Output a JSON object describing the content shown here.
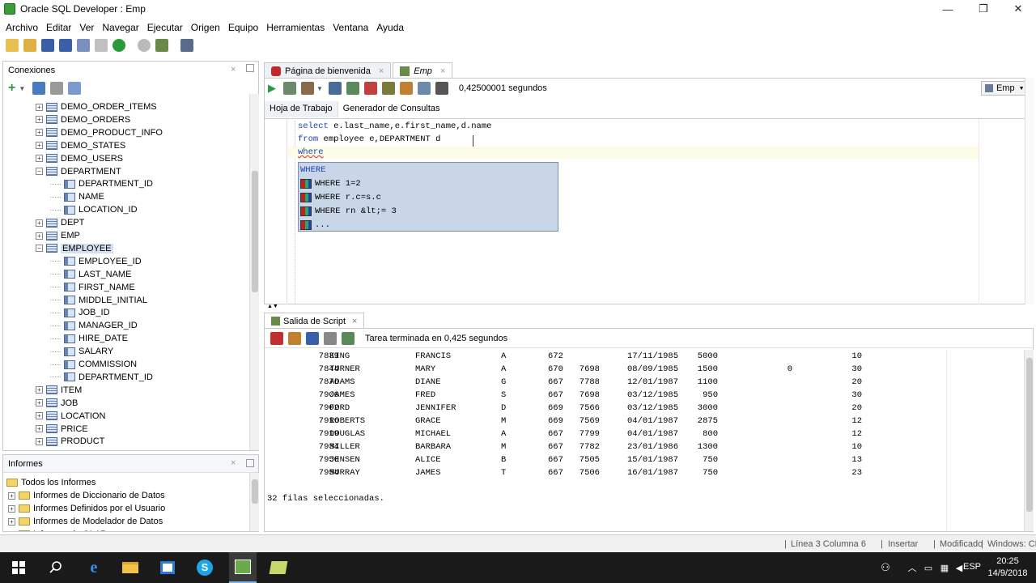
{
  "window": {
    "title": "Oracle SQL Developer : Emp",
    "min": "—",
    "max": "❐",
    "close": "✕"
  },
  "menu": [
    "Archivo",
    "Editar",
    "Ver",
    "Navegar",
    "Ejecutar",
    "Origen",
    "Equipo",
    "Herramientas",
    "Ventana",
    "Ayuda"
  ],
  "connections": {
    "title": "Conexiones",
    "items": [
      {
        "label": "DEMO_ORDER_ITEMS",
        "level": 1,
        "exp": "+",
        "kind": "table"
      },
      {
        "label": "DEMO_ORDERS",
        "level": 1,
        "exp": "+",
        "kind": "table"
      },
      {
        "label": "DEMO_PRODUCT_INFO",
        "level": 1,
        "exp": "+",
        "kind": "table"
      },
      {
        "label": "DEMO_STATES",
        "level": 1,
        "exp": "+",
        "kind": "table"
      },
      {
        "label": "DEMO_USERS",
        "level": 1,
        "exp": "+",
        "kind": "table"
      },
      {
        "label": "DEPARTMENT",
        "level": 1,
        "exp": "−",
        "kind": "table"
      },
      {
        "label": "DEPARTMENT_ID",
        "level": 2,
        "exp": "",
        "kind": "col"
      },
      {
        "label": "NAME",
        "level": 2,
        "exp": "",
        "kind": "col"
      },
      {
        "label": "LOCATION_ID",
        "level": 2,
        "exp": "",
        "kind": "col"
      },
      {
        "label": "DEPT",
        "level": 1,
        "exp": "+",
        "kind": "table"
      },
      {
        "label": "EMP",
        "level": 1,
        "exp": "+",
        "kind": "table"
      },
      {
        "label": "EMPLOYEE",
        "level": 1,
        "exp": "−",
        "kind": "table",
        "selected": true
      },
      {
        "label": "EMPLOYEE_ID",
        "level": 2,
        "exp": "",
        "kind": "col"
      },
      {
        "label": "LAST_NAME",
        "level": 2,
        "exp": "",
        "kind": "col"
      },
      {
        "label": "FIRST_NAME",
        "level": 2,
        "exp": "",
        "kind": "col"
      },
      {
        "label": "MIDDLE_INITIAL",
        "level": 2,
        "exp": "",
        "kind": "col"
      },
      {
        "label": "JOB_ID",
        "level": 2,
        "exp": "",
        "kind": "col"
      },
      {
        "label": "MANAGER_ID",
        "level": 2,
        "exp": "",
        "kind": "col"
      },
      {
        "label": "HIRE_DATE",
        "level": 2,
        "exp": "",
        "kind": "col"
      },
      {
        "label": "SALARY",
        "level": 2,
        "exp": "",
        "kind": "col"
      },
      {
        "label": "COMMISSION",
        "level": 2,
        "exp": "",
        "kind": "col"
      },
      {
        "label": "DEPARTMENT_ID",
        "level": 2,
        "exp": "",
        "kind": "col"
      },
      {
        "label": "ITEM",
        "level": 1,
        "exp": "+",
        "kind": "table"
      },
      {
        "label": "JOB",
        "level": 1,
        "exp": "+",
        "kind": "table"
      },
      {
        "label": "LOCATION",
        "level": 1,
        "exp": "+",
        "kind": "table"
      },
      {
        "label": "PRICE",
        "level": 1,
        "exp": "+",
        "kind": "table"
      },
      {
        "label": "PRODUCT",
        "level": 1,
        "exp": "+",
        "kind": "table"
      }
    ]
  },
  "reports": {
    "title": "Informes",
    "items": [
      "Todos los Informes",
      "Informes de Diccionario de Datos",
      "Informes Definidos por el Usuario",
      "Informes de Modelador de Datos",
      "Informes de OLAP"
    ]
  },
  "editor_tabs": [
    "Página de bienvenida",
    "Emp"
  ],
  "editor": {
    "timing": "0,42500001 segundos",
    "connection": "Emp",
    "subtabs": [
      "Hoja de Trabajo",
      "Generador de Consultas"
    ],
    "lines": [
      [
        {
          "t": "select ",
          "k": 1
        },
        {
          "t": "e.last_name,e.first_name,d.name",
          "k": 0
        }
      ],
      [
        {
          "t": "from ",
          "k": 1
        },
        {
          "t": "employee e,DEPARTMENT d",
          "k": 0
        }
      ],
      [
        {
          "t": "where",
          "k": 1
        }
      ]
    ],
    "suggestions": {
      "header": "WHERE",
      "items": [
        "WHERE 1=2",
        "WHERE r.c=s.c",
        "WHERE rn &lt;= 3",
        "..."
      ]
    }
  },
  "script_output": {
    "tab": "Salida de Script",
    "status": "Tarea terminada en 0,425 segundos",
    "rows": [
      [
        "7839",
        "KING",
        "FRANCIS",
        "A",
        "672",
        "",
        "17/11/1985",
        "5000",
        "",
        "10"
      ],
      [
        "7844",
        "TURNER",
        "MARY",
        "A",
        "670",
        "7698",
        "08/09/1985",
        "1500",
        "0",
        "30"
      ],
      [
        "7876",
        "ADAMS",
        "DIANE",
        "G",
        "667",
        "7788",
        "12/01/1987",
        "1100",
        "",
        "20"
      ],
      [
        "7900",
        "JAMES",
        "FRED",
        "S",
        "667",
        "7698",
        "03/12/1985",
        "950",
        "",
        "30"
      ],
      [
        "7902",
        "FORD",
        "JENNIFER",
        "D",
        "669",
        "7566",
        "03/12/1985",
        "3000",
        "",
        "20"
      ],
      [
        "7916",
        "ROBERTS",
        "GRACE",
        "M",
        "669",
        "7569",
        "04/01/1987",
        "2875",
        "",
        "12"
      ],
      [
        "7919",
        "DOUGLAS",
        "MICHAEL",
        "A",
        "667",
        "7799",
        "04/01/1987",
        "800",
        "",
        "12"
      ],
      [
        "7934",
        "MILLER",
        "BARBARA",
        "M",
        "667",
        "7782",
        "23/01/1986",
        "1300",
        "",
        "10"
      ],
      [
        "7950",
        "JENSEN",
        "ALICE",
        "B",
        "667",
        "7505",
        "15/01/1987",
        "750",
        "",
        "13"
      ],
      [
        "7954",
        "MURRAY",
        "JAMES",
        "T",
        "667",
        "7506",
        "16/01/1987",
        "750",
        "",
        "23"
      ]
    ],
    "footer": "32 filas seleccionadas."
  },
  "statusbar": {
    "position": "Línea 3 Columna 6",
    "mode": "Insertar",
    "modified": "Modificado",
    "eol": "Windows: CR"
  },
  "taskbar": {
    "time": "20:25",
    "date": "14/9/2018",
    "lang": "ESP"
  }
}
